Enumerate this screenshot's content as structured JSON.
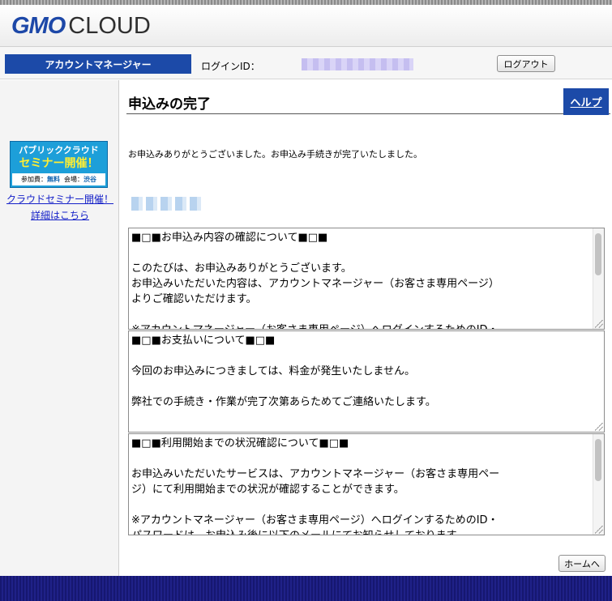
{
  "header": {
    "logo_gmo": "GMO",
    "logo_cloud": "CLOUD"
  },
  "bar": {
    "account_manager": "アカウントマネージャー",
    "login_id_label": "ログインID：",
    "logout_label": "ログアウト"
  },
  "sidebar": {
    "banner": {
      "line1": "パブリッククラウド",
      "line2": "セミナー開催！",
      "fee_label": "参加費：",
      "fee_value": "無料",
      "venue_label": "会場：",
      "venue_value": "渋谷"
    },
    "seminar_link": "クラウドセミナー開催！詳細はこちら"
  },
  "main": {
    "title": "申込みの完了",
    "help_label": "ヘルプ",
    "thanks_message": "お申込みありがとうございました。お申込み手続きが完了いたしました。",
    "box1": "■□■お申込み内容の確認について■□■\n\nこのたびは、お申込みありがとうございます。\nお申込みいただいた内容は、アカウントマネージャー（お客さま専用ページ）\nよりご確認いただけます。\n\n※アカウントマネージャー（お客さま専用ページ）へログインするためのID・",
    "box2": "■□■お支払いについて■□■\n\n今回のお申込みにつきましては、料金が発生いたしません。\n\n弊社での手続き・作業が完了次第あらためてご連絡いたします。",
    "box3": "■□■利用開始までの状況確認について■□■\n\nお申込みいただいたサービスは、アカウントマネージャー（お客さま専用ペー\nジ）にて利用開始までの状況が確認することができます。\n\n※アカウントマネージャー（お客さま専用ページ）へログインするためのID・\nパスワードは、お申込み後に以下のメールにてお知らせしております。",
    "home_label": "ホームへ"
  }
}
